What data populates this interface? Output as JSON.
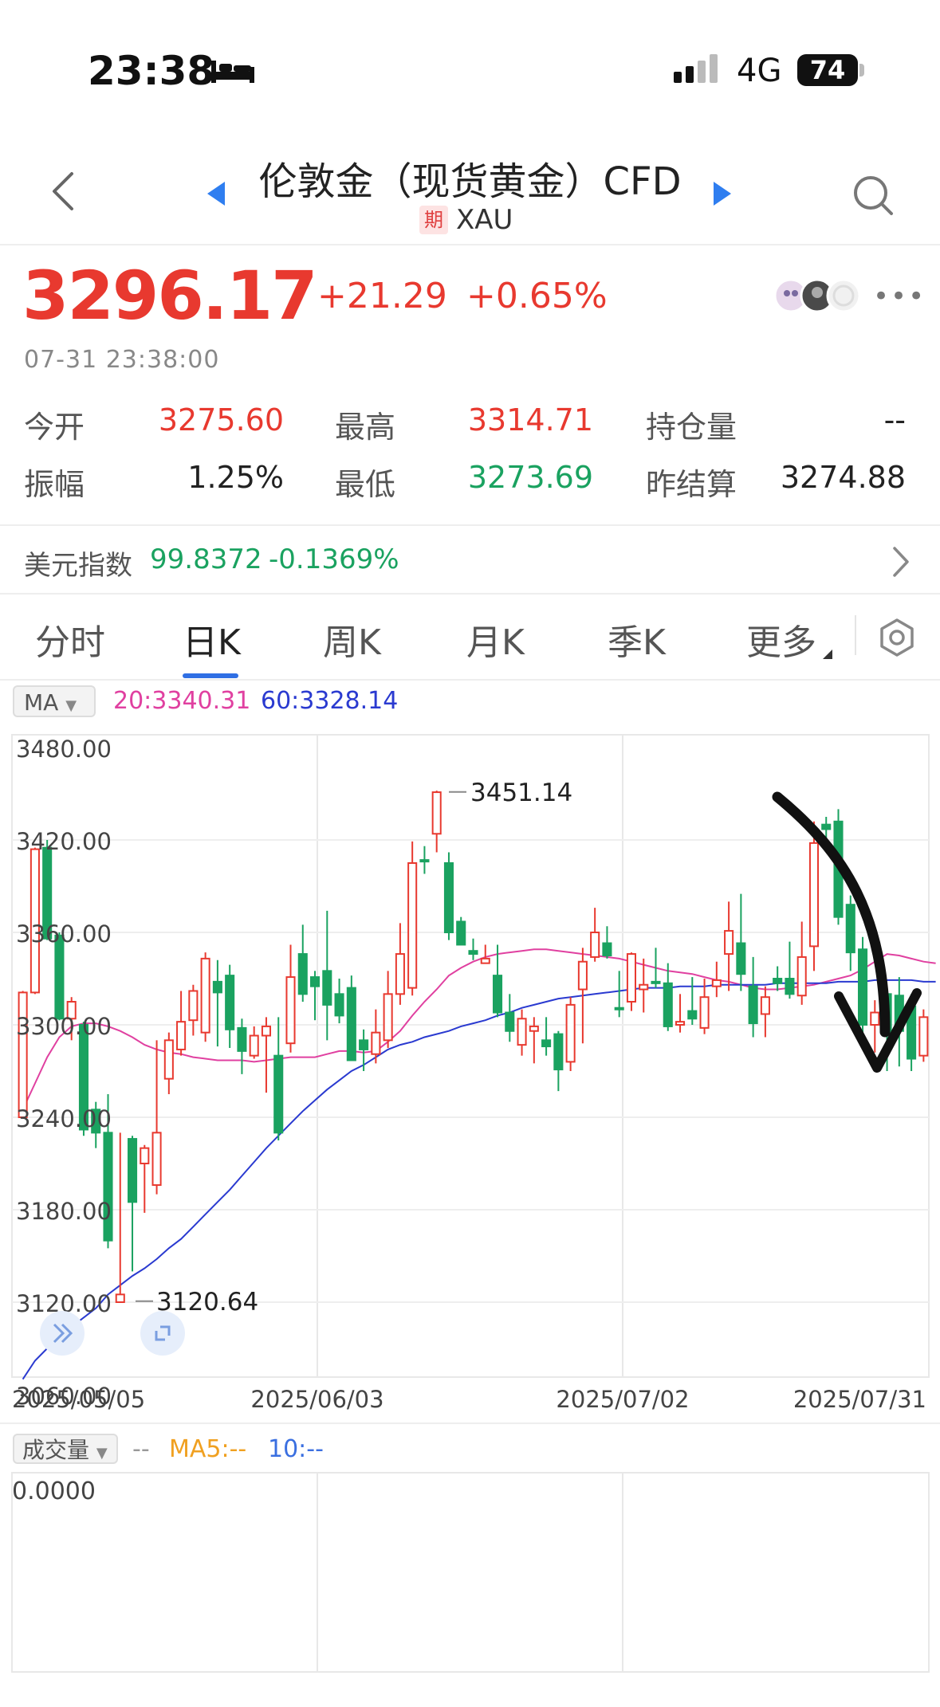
{
  "status_bar": {
    "time": "23:38",
    "network": "4G",
    "battery": "74"
  },
  "header": {
    "title": "伦敦金（现货黄金）CFD",
    "badge": "期",
    "symbol": "XAU"
  },
  "quote": {
    "price": "3296.17",
    "change": "+21.29",
    "change_pct": "+0.65%",
    "timestamp": "07-31 23:38:00"
  },
  "stats": {
    "open_label": "今开",
    "open": "3275.60",
    "high_label": "最高",
    "high": "3314.71",
    "oi_label": "持仓量",
    "oi": "--",
    "amp_label": "振幅",
    "amp": "1.25%",
    "low_label": "最低",
    "low": "3273.69",
    "settle_label": "昨结算",
    "settle": "3274.88"
  },
  "usd_index": {
    "label": "美元指数",
    "value": "99.8372",
    "change": "-0.1369%"
  },
  "tabs": [
    "分时",
    "日K",
    "周K",
    "月K",
    "季K",
    "更多"
  ],
  "active_tab": "日K",
  "indicators": {
    "ma_select": "MA",
    "ma20": "20:3340.31",
    "ma60": "60:3328.14"
  },
  "volume": {
    "select": "成交量",
    "dash": "--",
    "ma5": "MA5:--",
    "ma10": "10:--",
    "zero": "0.0000"
  },
  "colors": {
    "up": "#e8392f",
    "down": "#1aa260",
    "ma20": "#e040a0",
    "ma60": "#2a3ad0"
  },
  "chart_data": {
    "type": "candlestick",
    "y_ticks": [
      "3480.00",
      "3420.00",
      "3360.00",
      "3300.00",
      "3240.00",
      "3180.00",
      "3120.00",
      "3060.00"
    ],
    "x_ticks": [
      "2025/05/05",
      "2025/06/03",
      "2025/07/02",
      "2025/07/31"
    ],
    "ylim": [
      3060,
      3480
    ],
    "max_label": "3451.14",
    "min_label": "3120.64",
    "series": [
      {
        "name": "20",
        "values": [
          3245,
          3262,
          3279,
          3292,
          3299,
          3301,
          3301,
          3299,
          3296,
          3292,
          3287,
          3284,
          3282,
          3281,
          3279,
          3278,
          3277,
          3277,
          3277,
          3276,
          3277,
          3278,
          3279,
          3279,
          3279,
          3281,
          3283,
          3283,
          3282,
          3283,
          3289,
          3296,
          3306,
          3315,
          3323,
          3332,
          3337,
          3341,
          3344,
          3346,
          3347,
          3348,
          3349,
          3349,
          3348,
          3347,
          3346,
          3345,
          3344,
          3343,
          3341,
          3339,
          3337,
          3335,
          3334,
          3333,
          3331,
          3329,
          3328,
          3326,
          3324,
          3323,
          3323,
          3324,
          3325,
          3326,
          3328,
          3330,
          3332,
          3336,
          3341,
          3346,
          3345,
          3343,
          3341,
          3340
        ]
      },
      {
        "name": "60",
        "values": [
          3070,
          3082,
          3090,
          3098,
          3104,
          3110,
          3116,
          3125,
          3131,
          3137,
          3142,
          3148,
          3155,
          3161,
          3169,
          3177,
          3185,
          3193,
          3202,
          3211,
          3220,
          3228,
          3236,
          3244,
          3251,
          3258,
          3264,
          3270,
          3274,
          3279,
          3284,
          3287,
          3289,
          3292,
          3294,
          3296,
          3299,
          3301,
          3303,
          3306,
          3308,
          3311,
          3313,
          3315,
          3317,
          3318,
          3319,
          3320,
          3321,
          3322,
          3323,
          3324,
          3324,
          3324,
          3325,
          3325,
          3325,
          3326,
          3326,
          3326,
          3326,
          3326,
          3327,
          3327,
          3327,
          3327,
          3327,
          3328,
          3328,
          3328,
          3329,
          3329,
          3329,
          3329,
          3328,
          3328
        ]
      }
    ],
    "candles": [
      [
        3240,
        3321,
        3239,
        3322
      ],
      [
        3321,
        3414,
        3320,
        3415
      ],
      [
        3415,
        3356,
        3355,
        3420
      ],
      [
        3358,
        3304,
        3303,
        3360
      ],
      [
        3304,
        3315,
        3290,
        3318
      ],
      [
        3300,
        3232,
        3228,
        3302
      ],
      [
        3245,
        3230,
        3220,
        3250
      ],
      [
        3230,
        3160,
        3155,
        3255
      ],
      [
        3120,
        3125,
        3120,
        3230
      ],
      [
        3226,
        3185,
        3140,
        3228
      ],
      [
        3210,
        3220,
        3178,
        3222
      ],
      [
        3196,
        3230,
        3190,
        3290
      ],
      [
        3265,
        3290,
        3255,
        3295
      ],
      [
        3284,
        3302,
        3280,
        3322
      ],
      [
        3303,
        3322,
        3293,
        3326
      ],
      [
        3295,
        3343,
        3289,
        3347
      ],
      [
        3328,
        3321,
        3286,
        3342
      ],
      [
        3332,
        3297,
        3285,
        3339
      ],
      [
        3298,
        3283,
        3268,
        3304
      ],
      [
        3280,
        3293,
        3278,
        3299
      ],
      [
        3293,
        3299,
        3256,
        3305
      ],
      [
        3280,
        3230,
        3225,
        3305
      ],
      [
        3288,
        3331,
        3282,
        3352
      ],
      [
        3346,
        3320,
        3315,
        3365
      ],
      [
        3331,
        3325,
        3303,
        3335
      ],
      [
        3335,
        3313,
        3290,
        3374
      ],
      [
        3320,
        3306,
        3301,
        3330
      ],
      [
        3324,
        3277,
        3277,
        3332
      ],
      [
        3290,
        3284,
        3270,
        3297
      ],
      [
        3281,
        3295,
        3275,
        3310
      ],
      [
        3290,
        3320,
        3285,
        3335
      ],
      [
        3320,
        3346,
        3313,
        3366
      ],
      [
        3324,
        3405,
        3319,
        3419
      ],
      [
        3407,
        3406,
        3398,
        3416
      ],
      [
        3424,
        3451,
        3412,
        3452
      ],
      [
        3405,
        3360,
        3355,
        3412
      ],
      [
        3367,
        3352,
        3352,
        3370
      ],
      [
        3348,
        3346,
        3342,
        3356
      ],
      [
        3340,
        3343,
        3341,
        3352
      ],
      [
        3332,
        3308,
        3305,
        3352
      ],
      [
        3308,
        3296,
        3289,
        3320
      ],
      [
        3287,
        3304,
        3280,
        3310
      ],
      [
        3296,
        3299,
        3275,
        3305
      ],
      [
        3290,
        3286,
        3280,
        3305
      ],
      [
        3294,
        3271,
        3257,
        3296
      ],
      [
        3276,
        3313,
        3270,
        3318
      ],
      [
        3323,
        3341,
        3288,
        3350
      ],
      [
        3344,
        3360,
        3341,
        3376
      ],
      [
        3353,
        3345,
        3343,
        3364
      ],
      [
        3311,
        3310,
        3305,
        3335
      ],
      [
        3315,
        3346,
        3309,
        3347
      ],
      [
        3323,
        3326,
        3308,
        3343
      ],
      [
        3328,
        3327,
        3324,
        3350
      ],
      [
        3327,
        3299,
        3296,
        3340
      ],
      [
        3300,
        3302,
        3295,
        3320
      ],
      [
        3309,
        3304,
        3300,
        3331
      ],
      [
        3298,
        3318,
        3294,
        3330
      ],
      [
        3325,
        3329,
        3318,
        3341
      ],
      [
        3346,
        3361,
        3322,
        3380
      ],
      [
        3353,
        3333,
        3322,
        3385
      ],
      [
        3325,
        3301,
        3292,
        3344
      ],
      [
        3307,
        3318,
        3292,
        3325
      ],
      [
        3330,
        3327,
        3322,
        3338
      ],
      [
        3330,
        3320,
        3317,
        3354
      ],
      [
        3319,
        3344,
        3313,
        3367
      ],
      [
        3351,
        3418,
        3335,
        3432
      ],
      [
        3430,
        3427,
        3420,
        3435
      ],
      [
        3432,
        3370,
        3365,
        3440
      ],
      [
        3378,
        3347,
        3335,
        3384
      ],
      [
        3349,
        3300,
        3285,
        3357
      ],
      [
        3300,
        3308,
        3282,
        3316
      ],
      [
        3320,
        3293,
        3270,
        3322
      ],
      [
        3319,
        3296,
        3273,
        3331
      ],
      [
        3312,
        3278,
        3270,
        3320
      ],
      [
        3280,
        3305,
        3276,
        3310
      ]
    ]
  }
}
